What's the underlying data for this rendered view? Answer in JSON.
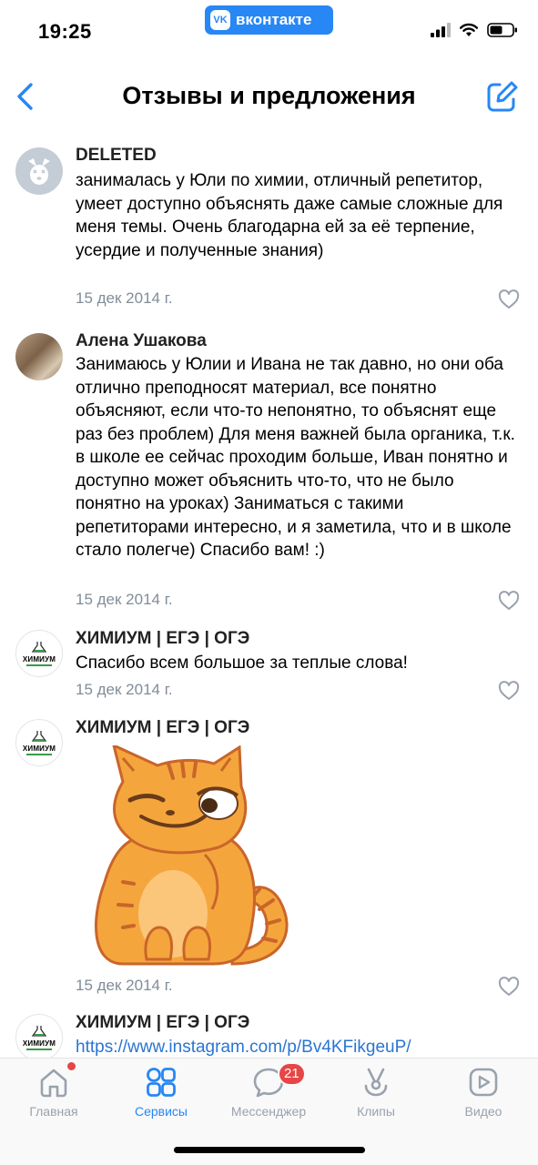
{
  "status_bar": {
    "time": "19:25",
    "app_pill": "вконтакте",
    "app_logo": "vk"
  },
  "nav": {
    "title": "Отзывы и предложения",
    "back_icon": "chevron-left-icon",
    "edit_icon": "edit-icon"
  },
  "posts": [
    {
      "author": "DELETED",
      "text": "занималась у Юли по химии, отличный репетитор, умеет доступно объяснять даже самые сложные для меня темы. Очень благодарна ей  за её терпение, усердие и полученные знания)",
      "date": "15 дек 2014 г."
    },
    {
      "author": "Алена Ушакова",
      "text": "Занимаюсь у Юлии и Ивана не так давно, но они оба отлично преподносят материал, все понятно объясняют, если что-то непонятно, то объяснят еще раз без проблем) Для меня важней была органика, т.к. в школе ее сейчас проходим больше, Иван понятно и доступно может объяснить что-то, что не было понятно на уроках) Заниматься с такими репетиторами интересно, и я заметила, что и в школе стало полегче) Спасибо вам! :)",
      "date": "15 дек 2014 г."
    },
    {
      "author": "ХИМИУМ | ЕГЭ | ОГЭ",
      "text": "Спасибо всем большое за теплые слова!",
      "date": "15 дек 2014 г."
    },
    {
      "author": "ХИМИУМ | ЕГЭ | ОГЭ",
      "sticker": "smirking-cat-sticker",
      "date": "15 дек 2014 г."
    },
    {
      "author": "ХИМИУМ | ЕГЭ | ОГЭ",
      "link": "https://www.instagram.com/p/Bv4KFikgeuP/"
    }
  ],
  "group_avatar_label": "ХИМИУМ",
  "tabs": [
    {
      "label": "Главная",
      "icon": "home-icon",
      "active": false,
      "dot": true
    },
    {
      "label": "Сервисы",
      "icon": "services-grid-icon",
      "active": true
    },
    {
      "label": "Мессенджер",
      "icon": "chat-bubble-icon",
      "active": false,
      "badge": "21"
    },
    {
      "label": "Клипы",
      "icon": "clips-icon",
      "active": false
    },
    {
      "label": "Видео",
      "icon": "video-icon",
      "active": false
    }
  ],
  "colors": {
    "accent": "#2787f5",
    "secondary_text": "#818c99",
    "badge": "#e64646",
    "link": "#2a75d1"
  }
}
